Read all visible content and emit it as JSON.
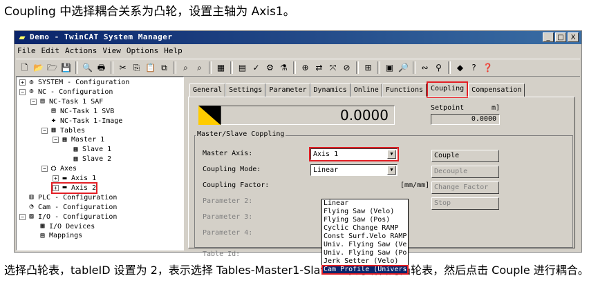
{
  "caption_top": "Coupling 中选择耦合关系为凸轮，设置主轴为 Axis1。",
  "caption_bottom": "选择凸轮表，tableID 设置为 2，表示选择 Tables-Master1-Slave2 中的编辑的凸轮表，然后点击 Couple 进行耦合。",
  "window": {
    "title": "Demo - TwinCAT System Manager",
    "min": "_",
    "max": "□",
    "close": "X"
  },
  "menu": [
    "File",
    "Edit",
    "Actions",
    "View",
    "Options",
    "Help"
  ],
  "toolbar_icons": [
    "new-icon",
    "open-icon",
    "open-folder-icon",
    "save-icon",
    "sep",
    "print-preview-icon",
    "print-icon",
    "sep",
    "cut-icon",
    "copy-icon",
    "paste-icon",
    "paste-link-icon",
    "sep",
    "find-icon",
    "find-next-icon",
    "sep",
    "generate-mappings-icon",
    "sep",
    "check-config-icon",
    "activate-icon",
    "set-run-icon",
    "config-mode-icon",
    "sep",
    "choose-target-icon",
    "scan-icon",
    "toggle-free-run-icon",
    "clear-icon",
    "sep",
    "show-variables-icon",
    "sep",
    "list-icon",
    "zoom-icon",
    "sep",
    "watch-icon",
    "route-icon",
    "sep",
    "diamond-icon",
    "help-icon",
    "whats-this-icon"
  ],
  "toolbar_glyphs": [
    "🗋",
    "📂",
    "🗁",
    "💾",
    "|",
    "🔍",
    "🖶",
    "|",
    "✂",
    "⎘",
    "📋",
    "⧉",
    "|",
    "⌕",
    "⌕",
    "|",
    "▦",
    "|",
    "▤",
    "✓",
    "⚙",
    "⚗",
    "|",
    "⊕",
    "⇄",
    "⤧",
    "⊘",
    "|",
    "⊞",
    "|",
    "▣",
    "🔎",
    "|",
    "∾",
    "⚲",
    "|",
    "◆",
    "?",
    "❓"
  ],
  "tree": [
    {
      "label": "SYSTEM - Configuration",
      "glyph": "⚙",
      "exp": "+",
      "depth": 0
    },
    {
      "label": "NC - Configuration",
      "glyph": "⚙",
      "exp": "−",
      "depth": 0
    },
    {
      "label": "NC-Task 1 SAF",
      "glyph": "▤",
      "exp": "−",
      "depth": 1
    },
    {
      "label": "NC-Task 1 SVB",
      "glyph": "▤",
      "exp": "",
      "depth": 2
    },
    {
      "label": "NC-Task 1-Image",
      "glyph": "✚",
      "exp": "",
      "depth": 2
    },
    {
      "label": "Tables",
      "glyph": "▦",
      "exp": "−",
      "depth": 2
    },
    {
      "label": "Master 1",
      "glyph": "▦",
      "exp": "−",
      "depth": 3
    },
    {
      "label": "Slave 1",
      "glyph": "▦",
      "exp": "",
      "depth": 4
    },
    {
      "label": "Slave 2",
      "glyph": "▦",
      "exp": "",
      "depth": 4
    },
    {
      "label": "Axes",
      "glyph": "⛭",
      "exp": "−",
      "depth": 2
    },
    {
      "label": "Axis 1",
      "glyph": "▬",
      "exp": "+",
      "depth": 3
    },
    {
      "label": "Axis 2",
      "glyph": "▬",
      "exp": "+",
      "depth": 3
    },
    {
      "label": "PLC - Configuration",
      "glyph": "▥",
      "exp": "",
      "depth": 0
    },
    {
      "label": "Cam - Configuration",
      "glyph": "◔",
      "exp": "",
      "depth": 0
    },
    {
      "label": "I/O - Configuration",
      "glyph": "▨",
      "exp": "−",
      "depth": 0
    },
    {
      "label": "I/O Devices",
      "glyph": "▩",
      "exp": "",
      "depth": 1
    },
    {
      "label": "Mappings",
      "glyph": "▤",
      "exp": "",
      "depth": 1
    }
  ],
  "tabs": [
    "General",
    "Settings",
    "Parameter",
    "Dynamics",
    "Online",
    "Functions",
    "Coupling",
    "Compensation"
  ],
  "active_tab": "Coupling",
  "display_value": "0.0000",
  "setpoint_label": "Setpoint",
  "setpoint_unit": "m]",
  "setpoint_value": "0.0000",
  "group_title": "Master/Slave Coppling",
  "fields": {
    "master_axis_label": "Master Axis:",
    "master_axis_value": "Axis 1",
    "coupling_mode_label": "Coupling Mode:",
    "coupling_mode_value": "Linear",
    "coupling_factor_label": "Coupling Factor:",
    "coupling_factor_unit": "[mm/mm]",
    "param2_label": "Parameter 2:",
    "param3_label": "Parameter 3:",
    "param4_label": "Parameter 4:",
    "table_id_label": "Table Id:"
  },
  "coupling_mode_options": [
    "Linear",
    "Flying Saw (Velo)",
    "Flying Saw (Pos)",
    "Cyclic Change RAMP",
    "Const Surf.Velo RAMP",
    "Univ. Flying Saw (Ve",
    "Univ. Flying Saw (Po",
    "Jerk Setter (Velo)",
    "Cam Profile (Univers"
  ],
  "selected_option": "Cam Profile (Univers",
  "buttons": {
    "couple": "Couple",
    "decouple": "Decouple",
    "change_factor": "Change Factor",
    "stop": "Stop"
  }
}
